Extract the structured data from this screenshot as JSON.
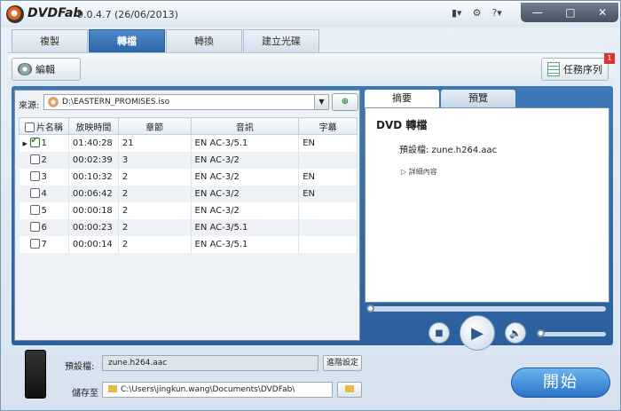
{
  "app": {
    "name": "DVDFab",
    "version": "9.0.4.7 (26/06/2013)"
  },
  "window_controls": {
    "minimize": "—",
    "maximize": "□",
    "close": "✕"
  },
  "title_icons": [
    "layout-icon",
    "gear-icon",
    "help-icon"
  ],
  "tabs": [
    {
      "label": "複製",
      "active": false
    },
    {
      "label": "轉檔",
      "active": true
    },
    {
      "label": "轉換",
      "active": false
    },
    {
      "label": "建立光碟",
      "active": false
    }
  ],
  "toolbar": {
    "edit_label": "編輯",
    "task_label": "任務序列",
    "task_badge": "1"
  },
  "source": {
    "label": "來源:",
    "path": "D:\\EASTERN_PROMISES.iso"
  },
  "table": {
    "headers": [
      "片名稱",
      "放映時間",
      "章節",
      "音訊",
      "字幕"
    ],
    "rows": [
      {
        "title": "1",
        "time": "01:40:28",
        "chapters": "21",
        "audio": "EN AC-3/5.1",
        "subtitle": "EN",
        "checked": true,
        "current": true
      },
      {
        "title": "2",
        "time": "00:02:39",
        "chapters": "3",
        "audio": "EN AC-3/2",
        "subtitle": "",
        "checked": false,
        "current": false
      },
      {
        "title": "3",
        "time": "00:10:32",
        "chapters": "2",
        "audio": "EN AC-3/2",
        "subtitle": "EN",
        "checked": false,
        "current": false
      },
      {
        "title": "4",
        "time": "00:06:42",
        "chapters": "2",
        "audio": "EN AC-3/2",
        "subtitle": "EN",
        "checked": false,
        "current": false
      },
      {
        "title": "5",
        "time": "00:00:18",
        "chapters": "2",
        "audio": "EN AC-3/2",
        "subtitle": "",
        "checked": false,
        "current": false
      },
      {
        "title": "6",
        "time": "00:00:23",
        "chapters": "2",
        "audio": "EN AC-3/5.1",
        "subtitle": "",
        "checked": false,
        "current": false
      },
      {
        "title": "7",
        "time": "00:00:14",
        "chapters": "2",
        "audio": "EN AC-3/5.1",
        "subtitle": "",
        "checked": false,
        "current": false
      }
    ]
  },
  "right_panel": {
    "tabs": [
      {
        "label": "摘要",
        "active": true
      },
      {
        "label": "預覽",
        "active": false
      }
    ],
    "title": "DVD 轉檔",
    "preset": "預設檔: zune.h264.aac",
    "detail": "▷ 詳細內容"
  },
  "bottom": {
    "preset_label": "預設檔:",
    "preset_value": "zune.h264.aac",
    "advanced_label": "進階設定",
    "save_label": "儲存至",
    "save_path": "C:\\Users\\jingkun.wang\\Documents\\DVDFab\\",
    "start_label": "開始"
  },
  "colors": {
    "accent": "#2c67a8",
    "start": "#2a74c8"
  }
}
